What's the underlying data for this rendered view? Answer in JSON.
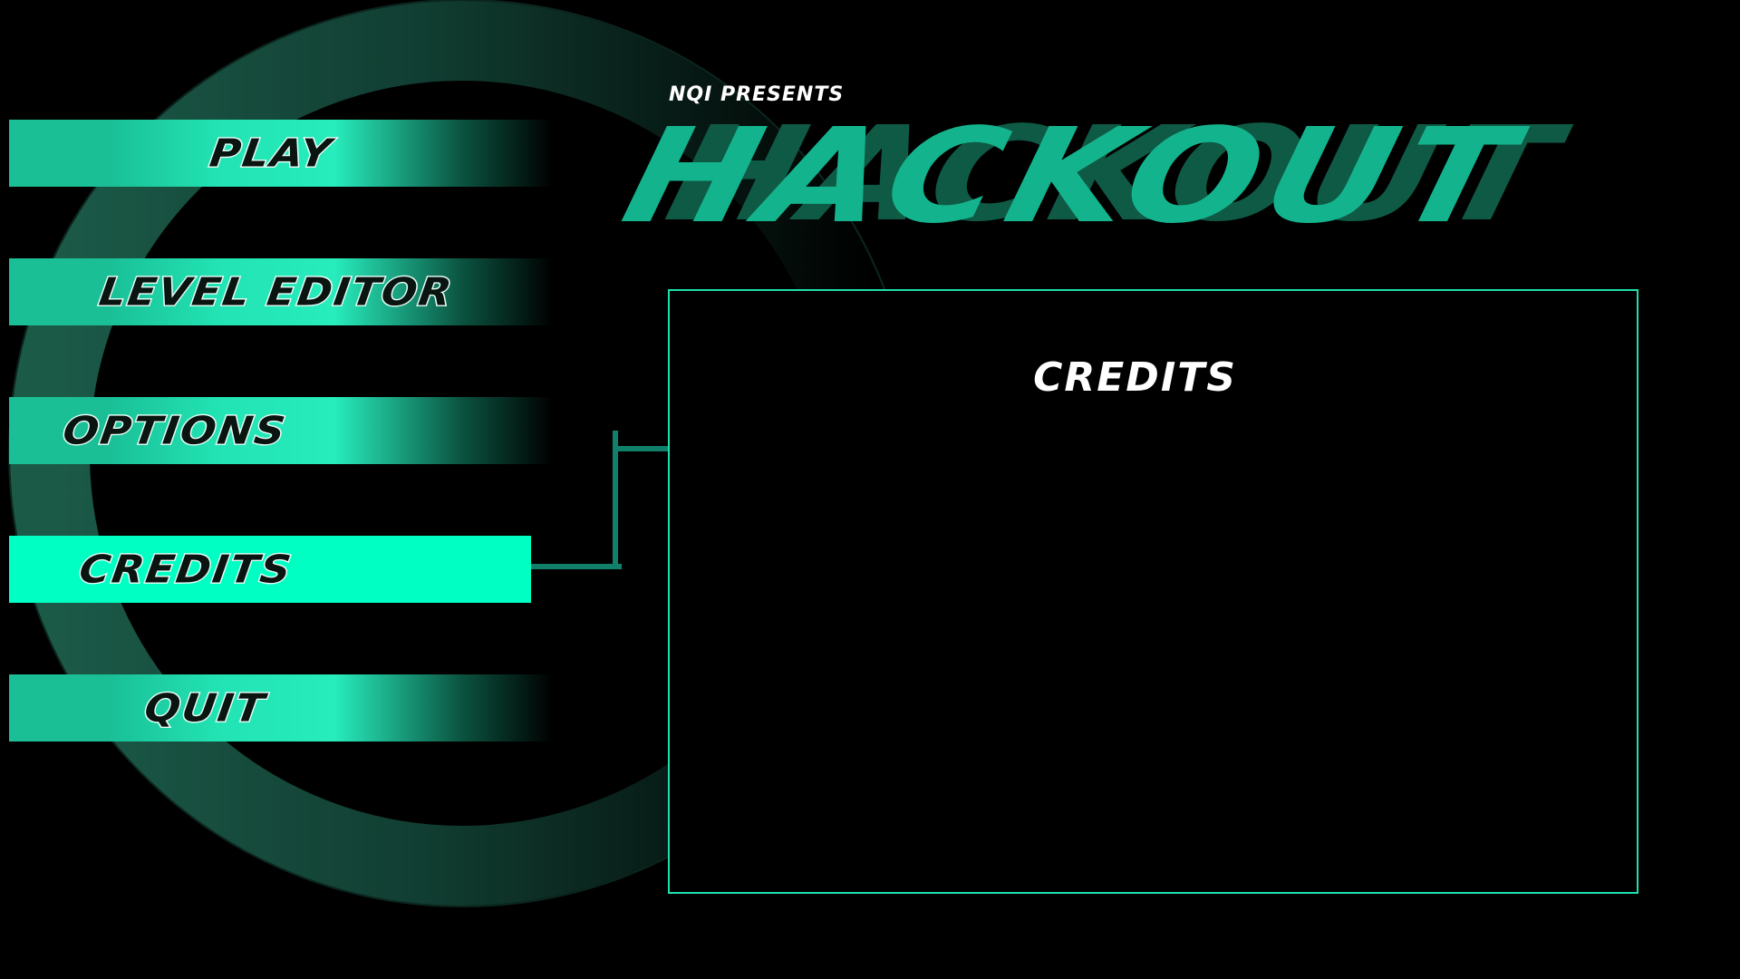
{
  "header": {
    "presents": "NQI PRESENTS",
    "title": "HACKOUT"
  },
  "menu": {
    "items": [
      {
        "label": "PLAY",
        "active": false
      },
      {
        "label": "LEVEL EDITOR",
        "active": false
      },
      {
        "label": "OPTIONS",
        "active": false
      },
      {
        "label": "CREDITS",
        "active": true
      },
      {
        "label": "QUIT",
        "active": false
      }
    ]
  },
  "panel": {
    "title": "CREDITS"
  },
  "colors": {
    "accent": "#00ffc3",
    "menu_fill": "#1abf96",
    "title": "#13b48d",
    "title_shadow": "#0f5a45",
    "panel_border": "#1ee0ae",
    "background": "#000000"
  }
}
